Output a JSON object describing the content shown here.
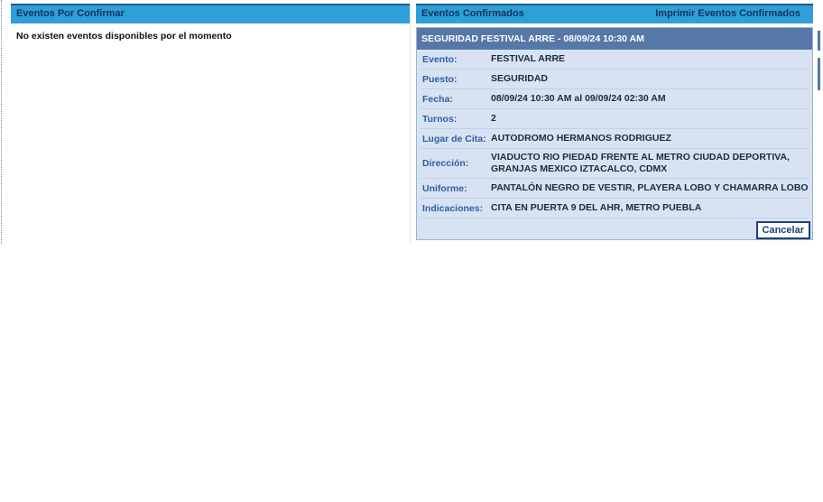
{
  "left_panel": {
    "title": "Eventos Por Confirmar",
    "empty_message": "No existen eventos disponibles por el momento"
  },
  "right_panel": {
    "title": "Eventos Confirmados",
    "print_label": "Imprimir Eventos Confirmados",
    "card": {
      "title": "SEGURIDAD FESTIVAL ARRE - 08/09/24 10:30 AM",
      "rows": [
        {
          "label": "Evento:",
          "value": "FESTIVAL ARRE"
        },
        {
          "label": "Puesto:",
          "value": "SEGURIDAD"
        },
        {
          "label": "Fecha:",
          "value": "08/09/24 10:30 AM al 09/09/24 02:30 AM"
        },
        {
          "label": "Turnos:",
          "value": "2"
        },
        {
          "label": "Lugar de Cita:",
          "value": "AUTODROMO HERMANOS RODRIGUEZ"
        },
        {
          "label": "Dirección:",
          "value": "VIADUCTO RIO PIEDAD FRENTE AL METRO CIUDAD DEPORTIVA, GRANJAS MEXICO IZTACALCO, CDMX"
        },
        {
          "label": "Uniforme:",
          "value": "PANTALÓN NEGRO DE VESTIR, PLAYERA LOBO Y CHAMARRA LOBO"
        },
        {
          "label": "Indicaciones:",
          "value": "CITA EN PUERTA 9 DEL AHR, METRO PUEBLA"
        }
      ],
      "cancel_label": "Cancelar"
    }
  },
  "colors": {
    "header_bg": "#2e9fd8",
    "card_title_bg": "#5677a8",
    "card_bg": "#d7e3f2",
    "label_color": "#2f5fa3"
  }
}
